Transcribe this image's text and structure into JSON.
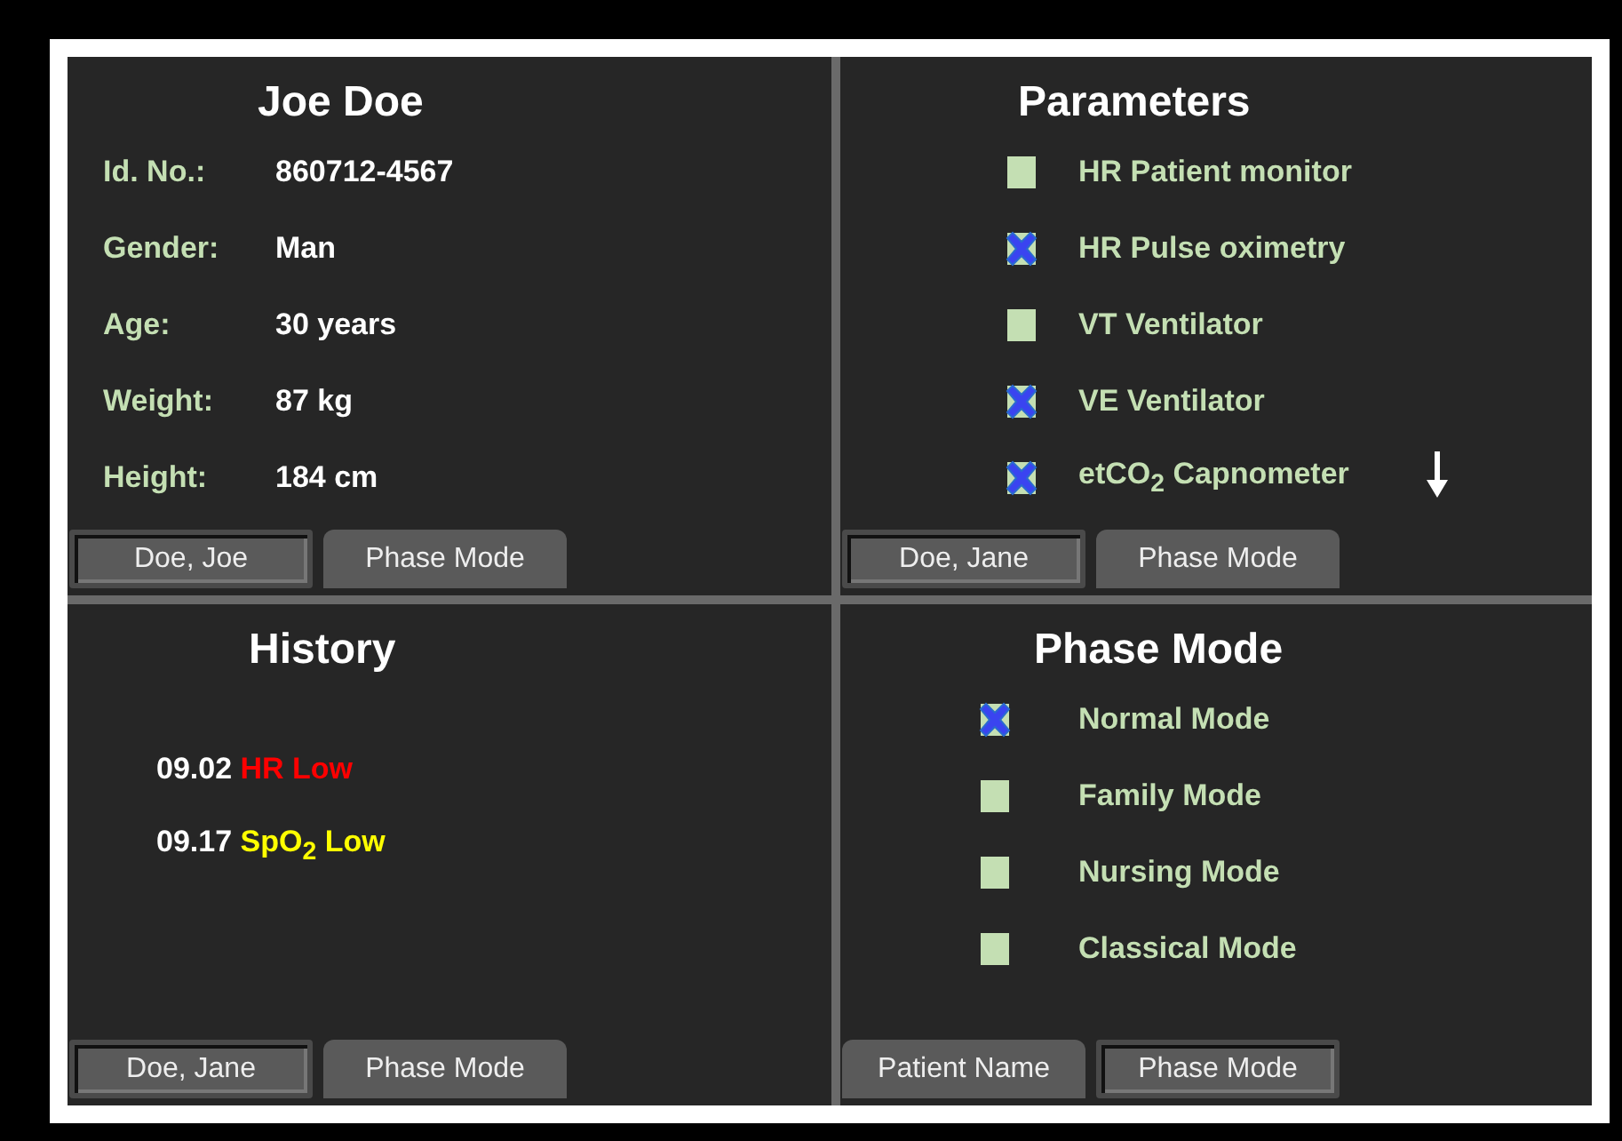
{
  "panels": [
    {
      "kind": "patient",
      "title": "Joe Doe",
      "fields": [
        {
          "label": "Id. No.:",
          "value": "860712-4567"
        },
        {
          "label": "Gender:",
          "value": "Man"
        },
        {
          "label": "Age:",
          "value": "30 years"
        },
        {
          "label": "Weight:",
          "value": "87 kg"
        },
        {
          "label": "Height:",
          "value": "184 cm"
        }
      ],
      "tabs": [
        {
          "label": "Doe, Joe",
          "selected": true
        },
        {
          "label": "Phase Mode",
          "selected": false
        }
      ]
    },
    {
      "kind": "checklist",
      "title": "Parameters",
      "scroll_arrow": true,
      "items": [
        {
          "label": "HR Patient monitor",
          "checked": false
        },
        {
          "label": "HR Pulse oximetry",
          "checked": true
        },
        {
          "label": "VT Ventilator",
          "checked": false
        },
        {
          "label": "VE Ventilator",
          "checked": true
        },
        {
          "label": "etCO$_{2}$ Capnometer",
          "checked": true
        }
      ],
      "tabs": [
        {
          "label": "Doe, Jane",
          "selected": true
        },
        {
          "label": "Phase Mode",
          "selected": false
        }
      ]
    },
    {
      "kind": "history",
      "title": "History",
      "events": [
        {
          "time": "09.02",
          "event": "HR Low",
          "color": "#ff0000"
        },
        {
          "time": "09.17",
          "event": "SpO$_{2}$ Low",
          "color": "#ffff00"
        }
      ],
      "tabs": [
        {
          "label": "Doe, Jane",
          "selected": true
        },
        {
          "label": "Phase Mode",
          "selected": false
        }
      ]
    },
    {
      "kind": "checklist",
      "title": "Phase Mode",
      "scroll_arrow": false,
      "items": [
        {
          "label": "Normal Mode",
          "checked": true
        },
        {
          "label": "Family Mode",
          "checked": false
        },
        {
          "label": "Nursing Mode",
          "checked": false
        },
        {
          "label": "Classical Mode",
          "checked": false
        }
      ],
      "tabs": [
        {
          "label": "Patient Name",
          "selected": false
        },
        {
          "label": "Phase Mode",
          "selected": true
        }
      ]
    }
  ]
}
